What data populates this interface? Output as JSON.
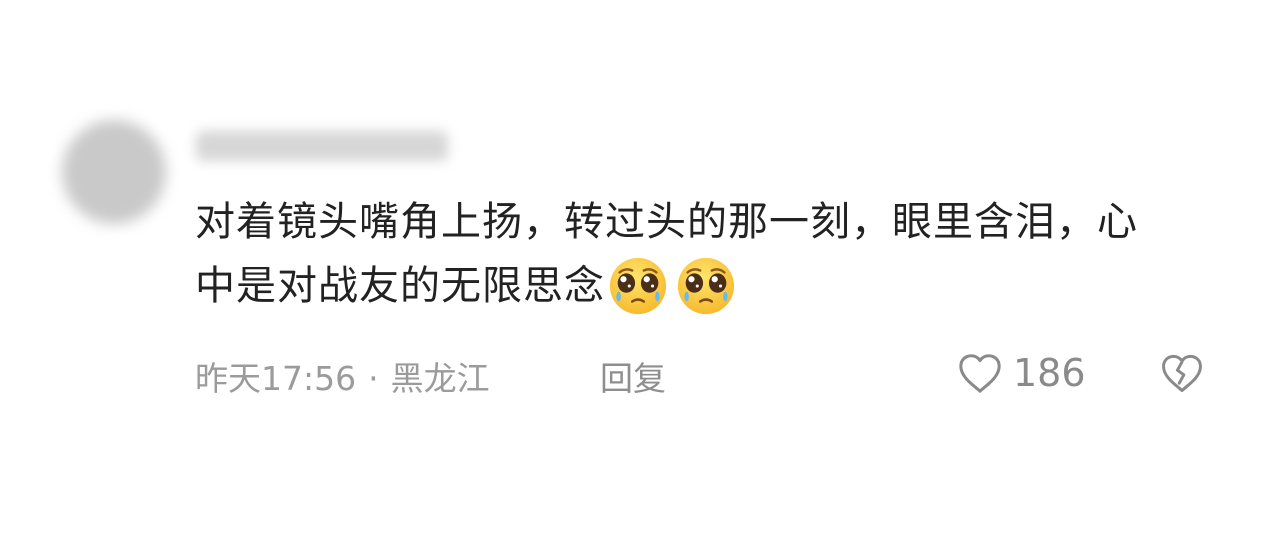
{
  "comment": {
    "text": "对着镜头嘴角上扬，转过头的那一刻，眼里含泪，心中是对战友的无限思念",
    "emojis": [
      "pleading-face-icon",
      "pleading-face-icon"
    ],
    "time": "昨天17:56",
    "separator": "·",
    "location": "黑龙江",
    "reply_label": "回复",
    "like_count": "186",
    "colors": {
      "text": "#222222",
      "meta": "#9b9b9b",
      "emoji": "#f8c93a"
    }
  }
}
